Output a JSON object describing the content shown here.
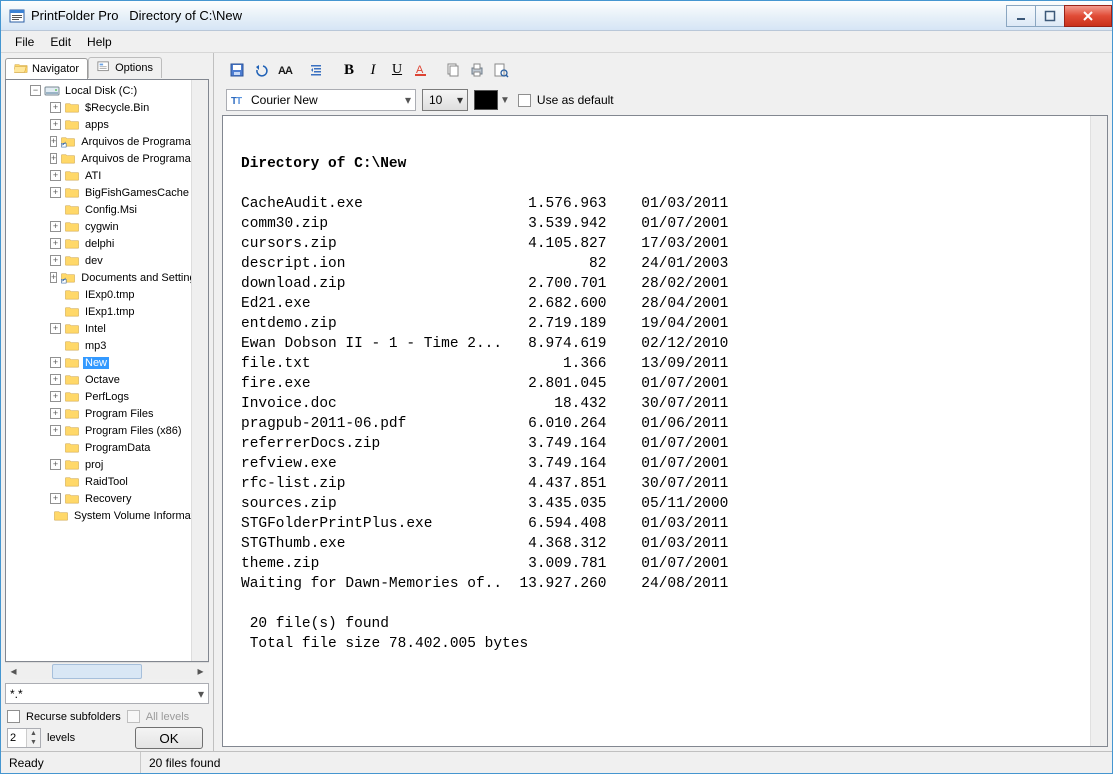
{
  "titlebar": {
    "app": "PrintFolder Pro",
    "doc": "Directory of C:\\New"
  },
  "menu": {
    "file": "File",
    "edit": "Edit",
    "help": "Help"
  },
  "tabs": {
    "navigator": "Navigator",
    "options": "Options"
  },
  "tree": {
    "root": "Local Disk (C:)",
    "items": [
      {
        "exp": "+",
        "icon": "folder",
        "label": "$Recycle.Bin"
      },
      {
        "exp": "+",
        "icon": "folder",
        "label": "apps"
      },
      {
        "exp": "+",
        "icon": "folder-sc",
        "label": "Arquivos de Programa"
      },
      {
        "exp": "+",
        "icon": "folder",
        "label": "Arquivos de Programas"
      },
      {
        "exp": "+",
        "icon": "folder",
        "label": "ATI"
      },
      {
        "exp": "+",
        "icon": "folder",
        "label": "BigFishGamesCache"
      },
      {
        "exp": "",
        "icon": "folder",
        "label": "Config.Msi"
      },
      {
        "exp": "+",
        "icon": "folder",
        "label": "cygwin"
      },
      {
        "exp": "+",
        "icon": "folder",
        "label": "delphi"
      },
      {
        "exp": "+",
        "icon": "folder",
        "label": "dev"
      },
      {
        "exp": "+",
        "icon": "folder-sc",
        "label": "Documents and Settings"
      },
      {
        "exp": "",
        "icon": "folder",
        "label": "IExp0.tmp"
      },
      {
        "exp": "",
        "icon": "folder",
        "label": "IExp1.tmp"
      },
      {
        "exp": "+",
        "icon": "folder",
        "label": "Intel"
      },
      {
        "exp": "",
        "icon": "folder",
        "label": "mp3"
      },
      {
        "exp": "+",
        "icon": "folder",
        "label": "New",
        "selected": true
      },
      {
        "exp": "+",
        "icon": "folder",
        "label": "Octave"
      },
      {
        "exp": "+",
        "icon": "folder",
        "label": "PerfLogs"
      },
      {
        "exp": "+",
        "icon": "folder",
        "label": "Program Files"
      },
      {
        "exp": "+",
        "icon": "folder",
        "label": "Program Files (x86)"
      },
      {
        "exp": "",
        "icon": "folder",
        "label": "ProgramData"
      },
      {
        "exp": "+",
        "icon": "folder",
        "label": "proj"
      },
      {
        "exp": "",
        "icon": "folder",
        "label": "RaidTool"
      },
      {
        "exp": "+",
        "icon": "folder",
        "label": "Recovery"
      },
      {
        "exp": "",
        "icon": "folder",
        "label": "System Volume Information"
      }
    ]
  },
  "filter": {
    "value": "*.*"
  },
  "opts": {
    "recurse": "Recurse subfolders",
    "all_levels": "All levels",
    "levels": "levels",
    "levels_val": "2",
    "ok": "OK"
  },
  "fontbar": {
    "font": "Courier New",
    "size": "10",
    "use_default": "Use as default"
  },
  "listing": {
    "title": "Directory of C:\\New",
    "files": [
      {
        "name": "CacheAudit.exe",
        "size": "1.576.963",
        "date": "01/03/2011"
      },
      {
        "name": "comm30.zip",
        "size": "3.539.942",
        "date": "01/07/2001"
      },
      {
        "name": "cursors.zip",
        "size": "4.105.827",
        "date": "17/03/2001"
      },
      {
        "name": "descript.ion",
        "size": "82",
        "date": "24/01/2003"
      },
      {
        "name": "download.zip",
        "size": "2.700.701",
        "date": "28/02/2001"
      },
      {
        "name": "Ed21.exe",
        "size": "2.682.600",
        "date": "28/04/2001"
      },
      {
        "name": "entdemo.zip",
        "size": "2.719.189",
        "date": "19/04/2001"
      },
      {
        "name": "Ewan Dobson II - 1 - Time 2...",
        "size": "8.974.619",
        "date": "02/12/2010"
      },
      {
        "name": "file.txt",
        "size": "1.366",
        "date": "13/09/2011"
      },
      {
        "name": "fire.exe",
        "size": "2.801.045",
        "date": "01/07/2001"
      },
      {
        "name": "Invoice.doc",
        "size": "18.432",
        "date": "30/07/2011"
      },
      {
        "name": "pragpub-2011-06.pdf",
        "size": "6.010.264",
        "date": "01/06/2011"
      },
      {
        "name": "referrerDocs.zip",
        "size": "3.749.164",
        "date": "01/07/2001"
      },
      {
        "name": "refview.exe",
        "size": "3.749.164",
        "date": "01/07/2001"
      },
      {
        "name": "rfc-list.zip",
        "size": "4.437.851",
        "date": "30/07/2011"
      },
      {
        "name": "sources.zip",
        "size": "3.435.035",
        "date": "05/11/2000"
      },
      {
        "name": "STGFolderPrintPlus.exe",
        "size": "6.594.408",
        "date": "01/03/2011"
      },
      {
        "name": "STGThumb.exe",
        "size": "4.368.312",
        "date": "01/03/2011"
      },
      {
        "name": "theme.zip",
        "size": "3.009.781",
        "date": "01/07/2001"
      },
      {
        "name": "Waiting for Dawn-Memories of..",
        "size": "13.927.260",
        "date": "24/08/2011"
      }
    ],
    "summary1": " 20 file(s) found",
    "summary2": " Total file size 78.402.005 bytes"
  },
  "status": {
    "left": "Ready",
    "right": "20 files found"
  }
}
